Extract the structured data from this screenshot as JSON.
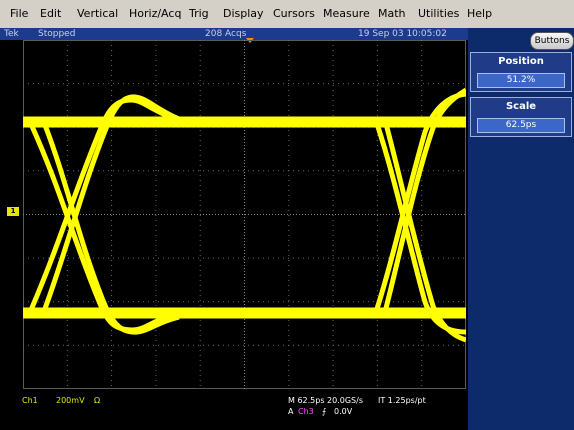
{
  "menu": {
    "items": [
      "File",
      "Edit",
      "Vertical",
      "Horiz/Acq",
      "Trig",
      "Display",
      "Cursors",
      "Measure",
      "Math",
      "Utilities",
      "Help"
    ]
  },
  "status": {
    "brand": "Tek",
    "state": "Stopped",
    "acqs": "208 Acqs",
    "datetime": "19 Sep 03 10:05:02"
  },
  "panel": {
    "buttons_label": "Buttons",
    "position": {
      "label": "Position",
      "value": "51.2%"
    },
    "scale": {
      "label": "Scale",
      "value": "62.5ps"
    }
  },
  "markers": {
    "ch1": "1"
  },
  "readout": {
    "channel": "Ch1",
    "volts_div": "200mV",
    "ohm": "Ω",
    "horizontal": "M 62.5ps 20.0GS/s",
    "it": "IT 1.25ps/pt",
    "trig_prefix": "A",
    "trig_source": "Ch3",
    "trig_slope": "⨍",
    "trig_level": "0.0V"
  },
  "colors": {
    "trace": "#ffff00",
    "ch1": "#e6e600",
    "trigger_source": "#ff55ff",
    "menubar": "#d4d0c8",
    "panel": "#0d2a6b",
    "status": "#1c3b8c"
  }
}
